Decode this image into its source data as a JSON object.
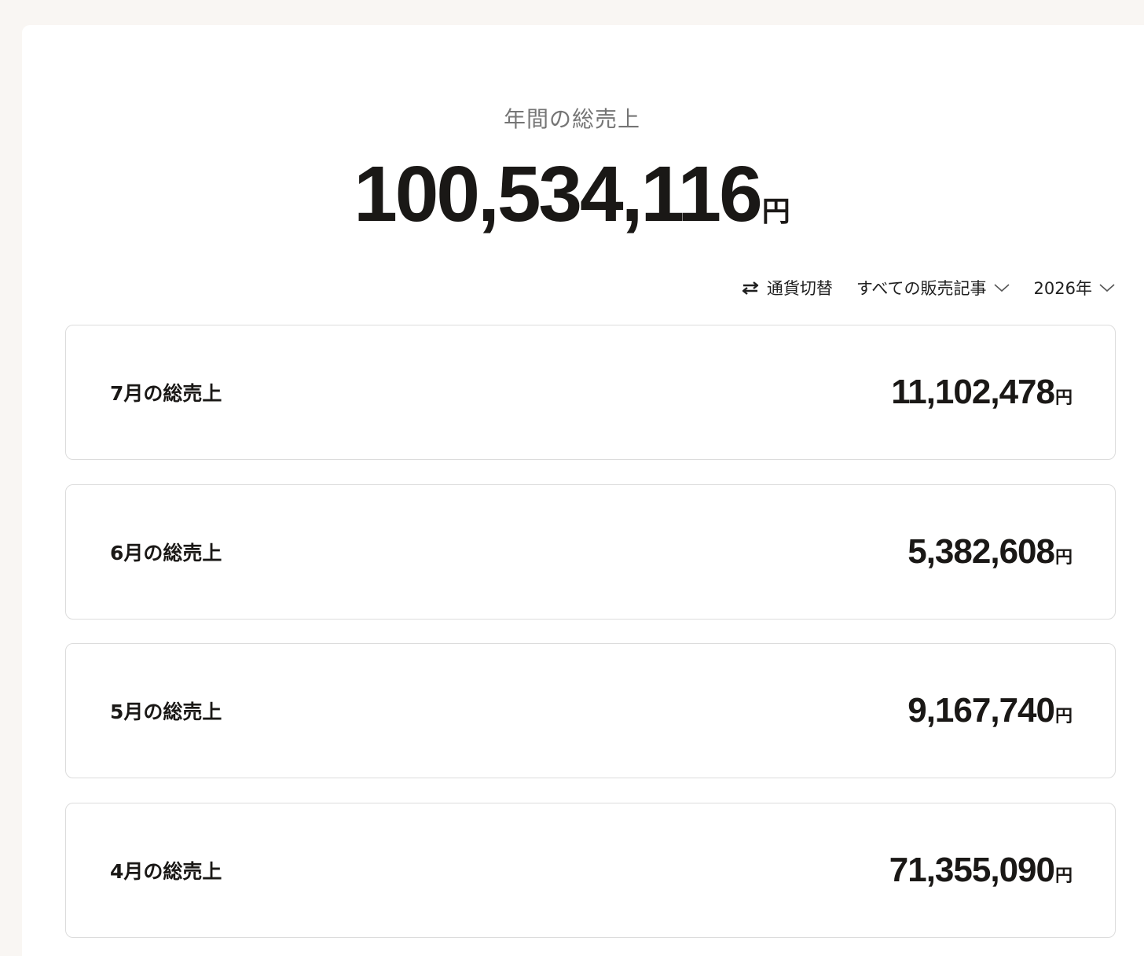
{
  "summary": {
    "label": "年間の総売上",
    "amount": "100,534,116",
    "unit": "円"
  },
  "controls": {
    "currency_switch": {
      "label": "通貨切替",
      "icon": "swap-arrows-icon"
    },
    "article_filter": {
      "label": "すべての販売記事",
      "icon": "chevron-down-icon"
    },
    "year_select": {
      "label": "2026年",
      "icon": "chevron-down-icon"
    }
  },
  "months": [
    {
      "label": "7月の総売上",
      "amount": "11,102,478",
      "unit": "円"
    },
    {
      "label": "6月の総売上",
      "amount": "5,382,608",
      "unit": "円"
    },
    {
      "label": "5月の総売上",
      "amount": "9,167,740",
      "unit": "円"
    },
    {
      "label": "4月の総売上",
      "amount": "71,355,090",
      "unit": "円"
    }
  ],
  "colors": {
    "page_background": "#f9f6f3",
    "panel_background": "#ffffff",
    "text_primary": "#1a1816",
    "text_muted": "#757575",
    "card_border": "#dcdcdc"
  }
}
